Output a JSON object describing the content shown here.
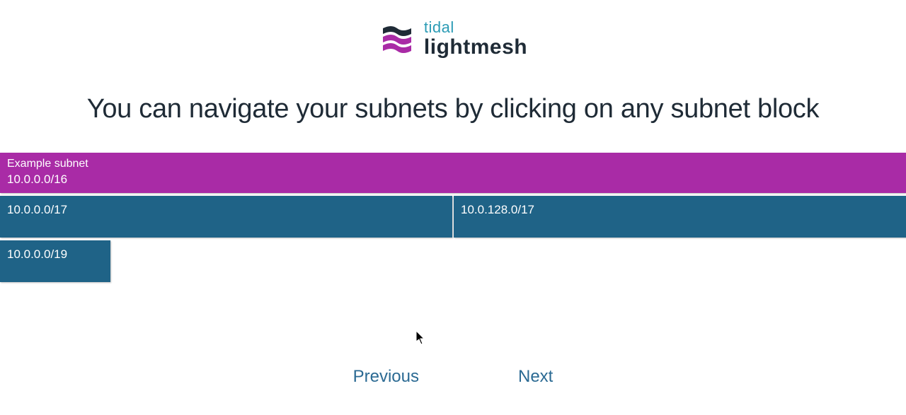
{
  "brand": {
    "top": "tidal",
    "bottom": "lightmesh"
  },
  "instruction": "You can navigate your subnets by clicking on any subnet block",
  "subnets": {
    "level1": {
      "name": "Example subnet",
      "cidr": "10.0.0.0/16"
    },
    "level2": [
      {
        "cidr": "10.0.0.0/17"
      },
      {
        "cidr": "10.0.128.0/17"
      }
    ],
    "level3": [
      {
        "cidr": "10.0.0.0/19"
      }
    ]
  },
  "nav": {
    "previous": "Previous",
    "next": "Next"
  },
  "colors": {
    "brandAccent": "#2b9bb5",
    "brandDark": "#1f2b36",
    "parentBlock": "#a92ba6",
    "childBlock": "#1f6387",
    "navLink": "#2b6a93"
  }
}
